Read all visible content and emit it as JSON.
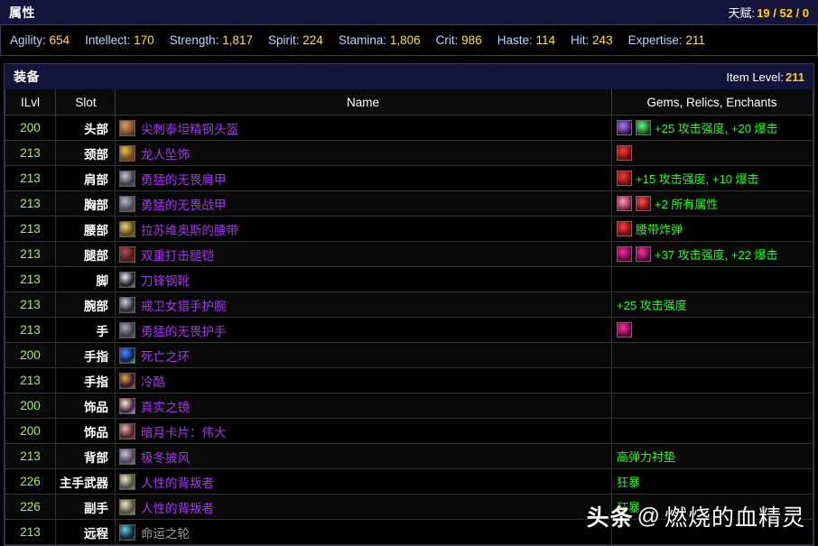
{
  "attributes_panel": {
    "title": "属性",
    "talent_label": "天赋:",
    "talent_value": "19 / 52 / 0",
    "stats": [
      {
        "key": "Agility:",
        "value": "654"
      },
      {
        "key": "Intellect:",
        "value": "170"
      },
      {
        "key": "Strength:",
        "value": "1,817"
      },
      {
        "key": "Spirit:",
        "value": "224"
      },
      {
        "key": "Stamina:",
        "value": "1,806"
      },
      {
        "key": "Crit:",
        "value": "986"
      },
      {
        "key": "Haste:",
        "value": "114"
      },
      {
        "key": "Hit:",
        "value": "243"
      },
      {
        "key": "Expertise:",
        "value": "211"
      }
    ]
  },
  "equipment_panel": {
    "title": "装备",
    "item_level_label": "Item Level:",
    "item_level_value": "211",
    "columns": {
      "ilvl": "ILvl",
      "slot": "Slot",
      "name": "Name",
      "gems": "Gems, Relics, Enchants"
    },
    "rows": [
      {
        "ilvl": "200",
        "slot": "头部",
        "name": "尖刺泰坦精钢头盔",
        "quality": "epic",
        "icon": {
          "name": "helm-icon",
          "c1": "#7a4a2a",
          "c2": "#d9a066",
          "c3": "#3a2418"
        },
        "gems": [
          {
            "name": "gem-purple-crescent",
            "c1": "#2a0b3a",
            "c2": "#b07bff"
          },
          {
            "name": "gem-green",
            "c1": "#0f3a16",
            "c2": "#5bff7a"
          }
        ],
        "enchant": "+25 攻击强度,  +20 爆击"
      },
      {
        "ilvl": "213",
        "slot": "颈部",
        "name": "龙人坠饰",
        "quality": "epic",
        "icon": {
          "name": "necklace-icon",
          "c1": "#6b4a18",
          "c2": "#e8c14a",
          "c3": "#c01a1a"
        },
        "gems": [
          {
            "name": "gem-red",
            "c1": "#5a0606",
            "c2": "#ff3b3b"
          }
        ],
        "enchant": ""
      },
      {
        "ilvl": "213",
        "slot": "肩部",
        "name": "勇猛的无畏肩甲",
        "quality": "epic",
        "icon": {
          "name": "shoulder-icon",
          "c1": "#3a3a42",
          "c2": "#c9c9d4",
          "c3": "#5c5c68"
        },
        "gems": [
          {
            "name": "gem-red",
            "c1": "#5a0606",
            "c2": "#ff3b3b"
          }
        ],
        "enchant": "+15 攻击强度,  +10 爆击"
      },
      {
        "ilvl": "213",
        "slot": "胸部",
        "name": "勇猛的无畏战甲",
        "quality": "epic",
        "icon": {
          "name": "chest-icon",
          "c1": "#4a4a55",
          "c2": "#b9b9c6",
          "c3": "#6a5a45"
        },
        "gems": [
          {
            "name": "gem-pink-bright",
            "c1": "#6b1030",
            "c2": "#ff9ec0"
          },
          {
            "name": "gem-red",
            "c1": "#5a0606",
            "c2": "#ff5050"
          }
        ],
        "enchant": "+2 所有属性"
      },
      {
        "ilvl": "213",
        "slot": "腰部",
        "name": "拉苏维奥斯的腰带",
        "quality": "epic",
        "icon": {
          "name": "belt-icon",
          "c1": "#5a4512",
          "c2": "#f0d27a",
          "c3": "#8c6a1e"
        },
        "gems": [
          {
            "name": "gem-red",
            "c1": "#5a0606",
            "c2": "#ff3b3b"
          }
        ],
        "enchant": "腰带炸弹"
      },
      {
        "ilvl": "213",
        "slot": "腿部",
        "name": "双重打击腿铠",
        "quality": "epic",
        "icon": {
          "name": "legs-icon",
          "c1": "#4a1a1a",
          "c2": "#b05050",
          "c3": "#7a2a2a"
        },
        "gems": [
          {
            "name": "gem-magenta",
            "c1": "#4a0030",
            "c2": "#ff2fa0"
          },
          {
            "name": "gem-magenta",
            "c1": "#4a0030",
            "c2": "#ff2fa0"
          }
        ],
        "enchant": "+37 攻击强度,  +22 爆击"
      },
      {
        "ilvl": "213",
        "slot": "脚",
        "name": "刀锋钢靴",
        "quality": "epic",
        "icon": {
          "name": "boots-icon",
          "c1": "#1a1a1a",
          "c2": "#e8e8f0",
          "c3": "#8a8a95"
        },
        "gems": [],
        "enchant": ""
      },
      {
        "ilvl": "213",
        "slot": "腕部",
        "name": "戒卫女猎手护腕",
        "quality": "epic",
        "icon": {
          "name": "bracer-icon",
          "c1": "#2a2a33",
          "c2": "#cfcfda",
          "c3": "#5a5a66"
        },
        "gems": [],
        "enchant": "+25 攻击强度"
      },
      {
        "ilvl": "213",
        "slot": "手",
        "name": "勇猛的无畏护手",
        "quality": "epic",
        "icon": {
          "name": "gloves-icon",
          "c1": "#3a3a44",
          "c2": "#a8a8b6",
          "c3": "#62626e"
        },
        "gems": [
          {
            "name": "gem-magenta",
            "c1": "#4a0030",
            "c2": "#ff2fa0"
          }
        ],
        "enchant": ""
      },
      {
        "ilvl": "200",
        "slot": "手指",
        "name": "死亡之环",
        "quality": "epic",
        "icon": {
          "name": "ring-blue-icon",
          "c1": "#101a4a",
          "c2": "#4a8cff",
          "c3": "#2de06a"
        },
        "gems": [],
        "enchant": ""
      },
      {
        "ilvl": "213",
        "slot": "手指",
        "name": "冷酷",
        "quality": "epic",
        "icon": {
          "name": "ring-gold-icon",
          "c1": "#2a1030",
          "c2": "#e8a33c",
          "c3": "#c97a1e"
        },
        "gems": [],
        "enchant": ""
      },
      {
        "ilvl": "200",
        "slot": "饰品",
        "name": "真实之镜",
        "quality": "epic",
        "icon": {
          "name": "trinket-star-icon",
          "c1": "#3a1a40",
          "c2": "#ffe9c9",
          "c3": "#d9a8e8"
        },
        "gems": [],
        "enchant": ""
      },
      {
        "ilvl": "200",
        "slot": "饰品",
        "name": "暗月卡片：伟大",
        "quality": "epic",
        "icon": {
          "name": "darkmoon-card-icon",
          "c1": "#4a2030",
          "c2": "#e8b0a0",
          "c3": "#a03a4a"
        },
        "gems": [],
        "enchant": ""
      },
      {
        "ilvl": "213",
        "slot": "背部",
        "name": "极冬披风",
        "quality": "epic",
        "icon": {
          "name": "cloak-icon",
          "c1": "#4a4055",
          "c2": "#cdbde0",
          "c3": "#8c7aa0"
        },
        "gems": [],
        "enchant": "高弹力衬垫"
      },
      {
        "ilvl": "226",
        "slot": "主手武器",
        "name": "人性的背叛者",
        "quality": "epic",
        "icon": {
          "name": "mainhand-weapon-icon",
          "c1": "#4a4a3a",
          "c2": "#e8e8c0",
          "c3": "#8c9470"
        },
        "gems": [],
        "enchant": "狂暴"
      },
      {
        "ilvl": "226",
        "slot": "副手",
        "name": "人性的背叛者",
        "quality": "epic",
        "icon": {
          "name": "offhand-weapon-icon",
          "c1": "#4a4a3a",
          "c2": "#e8e8c0",
          "c3": "#8c9470"
        },
        "gems": [],
        "enchant": "狂暴"
      },
      {
        "ilvl": "213",
        "slot": "远程",
        "name": "命运之轮",
        "quality": "poor",
        "icon": {
          "name": "ranged-weapon-icon",
          "c1": "#16202a",
          "c2": "#4fd8e8",
          "c3": "#2a3a4a"
        },
        "gems": [],
        "enchant": ""
      }
    ]
  },
  "watermark": {
    "brand": "头条",
    "at": "@",
    "author": "燃烧的血精灵"
  }
}
